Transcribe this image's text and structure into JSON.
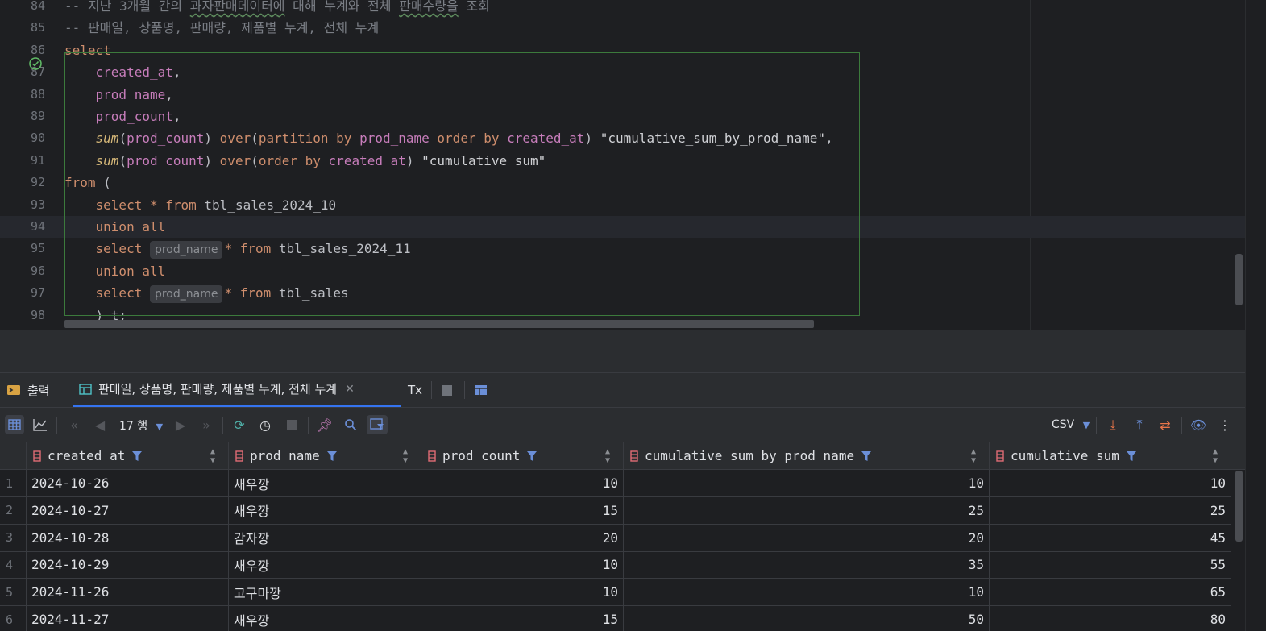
{
  "editor": {
    "lines": [
      {
        "n": "84",
        "segs": [
          [
            "comment",
            "-- 지난 3개월 간의 "
          ],
          [
            "comment underline",
            "과자판매데이터에"
          ],
          [
            "comment",
            " 대해 누계와 전체 "
          ],
          [
            "comment underline",
            "판매수량을"
          ],
          [
            "comment",
            " 조회"
          ]
        ]
      },
      {
        "n": "85",
        "segs": [
          [
            "comment",
            "-- 판매일, 상품명, 판매량, 제품별 누계, 전체 누계"
          ]
        ]
      },
      {
        "n": "86",
        "segs": [
          [
            "kw",
            "select"
          ]
        ]
      },
      {
        "n": "87",
        "segs": [
          [
            "prm",
            "    "
          ],
          [
            "col",
            "created_at"
          ],
          [
            "prm",
            ","
          ]
        ]
      },
      {
        "n": "88",
        "segs": [
          [
            "prm",
            "    "
          ],
          [
            "col",
            "prod_name"
          ],
          [
            "prm",
            ","
          ]
        ]
      },
      {
        "n": "89",
        "segs": [
          [
            "prm",
            "    "
          ],
          [
            "col",
            "prod_count"
          ],
          [
            "prm",
            ","
          ]
        ]
      },
      {
        "n": "90",
        "segs": [
          [
            "prm",
            "    "
          ],
          [
            "fnc",
            "sum"
          ],
          [
            "prm",
            "("
          ],
          [
            "col",
            "prod_count"
          ],
          [
            "prm",
            ") "
          ],
          [
            "kw",
            "over"
          ],
          [
            "prm",
            "("
          ],
          [
            "kw",
            "partition by "
          ],
          [
            "col",
            "prod_name"
          ],
          [
            "kw",
            " order by "
          ],
          [
            "col",
            "created_at"
          ],
          [
            "prm",
            ") "
          ],
          [
            "str",
            "\"cumulative_sum_by_prod_name\""
          ],
          [
            "prm",
            ","
          ]
        ]
      },
      {
        "n": "91",
        "segs": [
          [
            "prm",
            "    "
          ],
          [
            "fnc",
            "sum"
          ],
          [
            "prm",
            "("
          ],
          [
            "col",
            "prod_count"
          ],
          [
            "prm",
            ") "
          ],
          [
            "kw",
            "over"
          ],
          [
            "prm",
            "("
          ],
          [
            "kw",
            "order by "
          ],
          [
            "col",
            "created_at"
          ],
          [
            "prm",
            ") "
          ],
          [
            "str",
            "\"cumulative_sum\""
          ]
        ]
      },
      {
        "n": "92",
        "segs": [
          [
            "kw",
            "from"
          ],
          [
            "prm",
            " ("
          ]
        ]
      },
      {
        "n": "93",
        "segs": [
          [
            "prm",
            "    "
          ],
          [
            "kw",
            "select"
          ],
          [
            "prm",
            " "
          ],
          [
            "kw",
            "*"
          ],
          [
            "prm",
            " "
          ],
          [
            "kw",
            "from"
          ],
          [
            "prm",
            " tbl_sales_2024_10"
          ]
        ]
      },
      {
        "n": "94",
        "segs": [
          [
            "prm",
            "    "
          ],
          [
            "kw",
            "union all"
          ]
        ]
      },
      {
        "n": "95",
        "segs": [
          [
            "prm",
            "    "
          ],
          [
            "kw",
            "select"
          ],
          [
            "prm",
            " "
          ],
          [
            "hint",
            "prod_name"
          ],
          [
            "kw",
            "*"
          ],
          [
            "prm",
            " "
          ],
          [
            "kw",
            "from"
          ],
          [
            "prm",
            " tbl_sales_2024_11"
          ]
        ]
      },
      {
        "n": "96",
        "segs": [
          [
            "prm",
            "    "
          ],
          [
            "kw",
            "union all"
          ]
        ]
      },
      {
        "n": "97",
        "segs": [
          [
            "prm",
            "    "
          ],
          [
            "kw",
            "select"
          ],
          [
            "prm",
            " "
          ],
          [
            "hint",
            "prod_name"
          ],
          [
            "kw",
            "*"
          ],
          [
            "prm",
            " "
          ],
          [
            "kw",
            "from"
          ],
          [
            "prm",
            " tbl_sales"
          ]
        ]
      },
      {
        "n": "98",
        "segs": [
          [
            "prm",
            "    ) t;"
          ]
        ]
      }
    ],
    "current_line": "94",
    "colors": {
      "keyword": "#cf8e6d",
      "column": "#c77dbb",
      "comment": "#7a7e85",
      "accent": "#3574f0"
    }
  },
  "tabs": {
    "output_label": "출력",
    "result_label": "판매일, 상품명, 판매량, 제품별 누계, 전체 누계",
    "tx_label": "Tx"
  },
  "toolbar": {
    "rows_label": "17 행",
    "export_format": "CSV"
  },
  "table": {
    "columns": [
      "created_at",
      "prod_name",
      "prod_count",
      "cumulative_sum_by_prod_name",
      "cumulative_sum"
    ],
    "rows": [
      [
        "1",
        "2024-10-26",
        "새우깡",
        "10",
        "10",
        "10"
      ],
      [
        "2",
        "2024-10-27",
        "새우깡",
        "15",
        "25",
        "25"
      ],
      [
        "3",
        "2024-10-28",
        "감자깡",
        "20",
        "20",
        "45"
      ],
      [
        "4",
        "2024-10-29",
        "새우깡",
        "10",
        "35",
        "55"
      ],
      [
        "5",
        "2024-11-26",
        "고구마깡",
        "10",
        "10",
        "65"
      ],
      [
        "6",
        "2024-11-27",
        "새우깡",
        "15",
        "50",
        "80"
      ]
    ]
  }
}
